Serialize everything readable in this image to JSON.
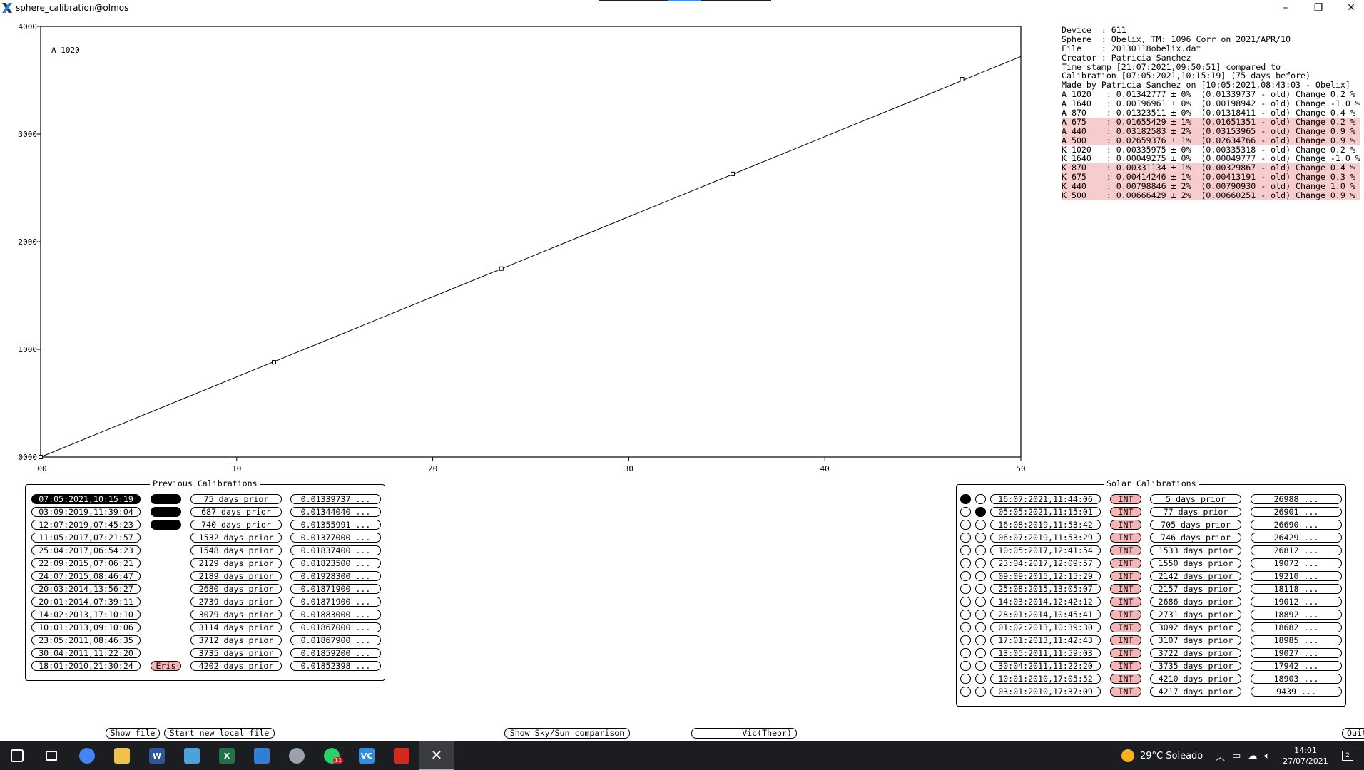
{
  "window": {
    "title": "sphere_calibration@olmos",
    "minimize_glyph": "–",
    "restore_glyph": "❐",
    "close_glyph": "✕"
  },
  "chart_data": {
    "type": "line",
    "annotation": "A 1020",
    "xlim": [
      0,
      50
    ],
    "ylim": [
      0,
      4000
    ],
    "x_ticks": [
      10,
      20,
      30,
      40,
      50
    ],
    "x_tick_labels": [
      "10",
      "20",
      "30",
      "40",
      "50"
    ],
    "x_origin_label": "00",
    "y_ticks": [
      1000,
      2000,
      3000,
      4000
    ],
    "y_tick_labels": [
      "1000",
      "2000",
      "3000",
      "4000"
    ],
    "y_origin_label": "0000",
    "line": {
      "x": [
        0,
        50
      ],
      "y": [
        0,
        3720
      ]
    },
    "points": {
      "x": [
        0,
        11.9,
        23.5,
        35.3,
        47.0
      ],
      "y": [
        0,
        880,
        1750,
        2630,
        3510
      ]
    }
  },
  "info": {
    "rows": [
      {
        "text": "Device  : 611",
        "hl": false
      },
      {
        "text": "Sphere  : Obelix, TM: 1096 Corr on 2021/APR/10",
        "hl": false
      },
      {
        "text": "File    : 20130118obelix.dat",
        "hl": false
      },
      {
        "text": "Creator : Patricia Sanchez",
        "hl": false
      },
      {
        "text": "Time stamp [21:07:2021,09:50:51] compared to",
        "hl": false
      },
      {
        "text": "Calibration [07:05:2021,10:15:19] (75 days before)",
        "hl": false
      },
      {
        "text": "Made by Patricia Sanchez on [10:05:2021,08:43:03 - Obelix]",
        "hl": false
      },
      {
        "text": "A 1020   : 0.01342777 ± 0%  (0.01339737 - old) Change 0.2 %",
        "hl": false
      },
      {
        "text": "A 1640   : 0.00196961 ± 0%  (0.00198942 - old) Change -1.0 %",
        "hl": false
      },
      {
        "text": "A 870    : 0.01323511 ± 0%  (0.01318411 - old) Change 0.4 %",
        "hl": false
      },
      {
        "text": "A 675    : 0.01655429 ± 1%  (0.01651351 - old) Change 0.2 %",
        "hl": true
      },
      {
        "text": "A 440    : 0.03182583 ± 2%  (0.03153965 - old) Change 0.9 %",
        "hl": true
      },
      {
        "text": "A 500    : 0.02659376 ± 1%  (0.02634766 - old) Change 0.9 %",
        "hl": true
      },
      {
        "text": "K 1020   : 0.00335975 ± 0%  (0.00335318 - old) Change 0.2 %",
        "hl": false
      },
      {
        "text": "K 1640   : 0.00049275 ± 0%  (0.00049777 - old) Change -1.0 %",
        "hl": false
      },
      {
        "text": "K 870    : 0.00331134 ± 1%  (0.00329867 - old) Change 0.4 %",
        "hl": true
      },
      {
        "text": "K 675    : 0.00414246 ± 1%  (0.00413191 - old) Change 0.3 %",
        "hl": true
      },
      {
        "text": "K 440    : 0.00798846 ± 2%  (0.00790930 - old) Change 1.0 %",
        "hl": true
      },
      {
        "text": "K 500    : 0.00666429 ± 2%  (0.00660251 - old) Change 0.9 %",
        "hl": true
      }
    ]
  },
  "previous_calibrations": {
    "title": "Previous Calibrations",
    "rows": [
      {
        "date": "07:05:2021,10:15:19",
        "selected": true,
        "tag": "",
        "tag_style": "black",
        "days": "75 days prior",
        "value": "0.01339737 ..."
      },
      {
        "date": "03:09:2019,11:39:04",
        "selected": false,
        "tag": "",
        "tag_style": "black",
        "days": "687 days prior",
        "value": "0.01344040 ..."
      },
      {
        "date": "12:07:2019,07:45:23",
        "selected": false,
        "tag": "",
        "tag_style": "black",
        "days": "740 days prior",
        "value": "0.01355991 ..."
      },
      {
        "date": "11:05:2017,07:21:57",
        "selected": false,
        "tag": "",
        "tag_style": "none",
        "days": "1532 days prior",
        "value": "0.01377000 ..."
      },
      {
        "date": "25:04:2017,06:54:23",
        "selected": false,
        "tag": "",
        "tag_style": "none",
        "days": "1548 days prior",
        "value": "0.01837400 ..."
      },
      {
        "date": "22:09:2015,07:06:21",
        "selected": false,
        "tag": "",
        "tag_style": "none",
        "days": "2129 days prior",
        "value": "0.01823500 ..."
      },
      {
        "date": "24:07:2015,08:46:47",
        "selected": false,
        "tag": "",
        "tag_style": "none",
        "days": "2189 days prior",
        "value": "0.01928300 ..."
      },
      {
        "date": "20:03:2014,13:56:27",
        "selected": false,
        "tag": "",
        "tag_style": "none",
        "days": "2680 days prior",
        "value": "0.01871900 ..."
      },
      {
        "date": "20:01:2014,07:39:11",
        "selected": false,
        "tag": "",
        "tag_style": "none",
        "days": "2739 days prior",
        "value": "0.01871900 ..."
      },
      {
        "date": "14:02:2013,17:10:10",
        "selected": false,
        "tag": "",
        "tag_style": "none",
        "days": "3079 days prior",
        "value": "0.01883000 ..."
      },
      {
        "date": "10:01:2013,09:10:06",
        "selected": false,
        "tag": "",
        "tag_style": "none",
        "days": "3114 days prior",
        "value": "0.01867000 ..."
      },
      {
        "date": "23:05:2011,08:46:35",
        "selected": false,
        "tag": "",
        "tag_style": "none",
        "days": "3712 days prior",
        "value": "0.01867900 ..."
      },
      {
        "date": "30:04:2011,11:22:20",
        "selected": false,
        "tag": "",
        "tag_style": "none",
        "days": "3735 days prior",
        "value": "0.01859200 ..."
      },
      {
        "date": "18:01:2010,21:30:24",
        "selected": false,
        "tag": "Eris",
        "tag_style": "red",
        "days": "4202 days prior",
        "value": "0.01852398 ..."
      }
    ]
  },
  "solar_calibrations": {
    "title": "Solar Calibrations",
    "rows": [
      {
        "r1": true,
        "r2": false,
        "date": "16:07:2021,11:44:06",
        "type": "INT",
        "days": "5 days prior",
        "value": "26988 ..."
      },
      {
        "r1": false,
        "r2": true,
        "date": "05:05:2021,11:15:01",
        "type": "INT",
        "days": "77 days prior",
        "value": "26901 ..."
      },
      {
        "r1": false,
        "r2": false,
        "date": "16:08:2019,11:53:42",
        "type": "INT",
        "days": "705 days prior",
        "value": "26690 ..."
      },
      {
        "r1": false,
        "r2": false,
        "date": "06:07:2019,11:53:29",
        "type": "INT",
        "days": "746 days prior",
        "value": "26429 ..."
      },
      {
        "r1": false,
        "r2": false,
        "date": "10:05:2017,12:41:54",
        "type": "INT",
        "days": "1533 days prior",
        "value": "26812 ..."
      },
      {
        "r1": false,
        "r2": false,
        "date": "23:04:2017,12:09:57",
        "type": "INT",
        "days": "1550 days prior",
        "value": "19072 ..."
      },
      {
        "r1": false,
        "r2": false,
        "date": "09:09:2015,12:15:29",
        "type": "INT",
        "days": "2142 days prior",
        "value": "19210 ..."
      },
      {
        "r1": false,
        "r2": false,
        "date": "25:08:2015,13:05:07",
        "type": "INT",
        "days": "2157 days prior",
        "value": "18118 ..."
      },
      {
        "r1": false,
        "r2": false,
        "date": "14:03:2014,12:42:12",
        "type": "INT",
        "days": "2686 days prior",
        "value": "19012 ..."
      },
      {
        "r1": false,
        "r2": false,
        "date": "28:01:2014,10:45:41",
        "type": "INT",
        "days": "2731 days prior",
        "value": "18892 ..."
      },
      {
        "r1": false,
        "r2": false,
        "date": "01:02:2013,10:39:30",
        "type": "INT",
        "days": "3092 days prior",
        "value": "18682 ..."
      },
      {
        "r1": false,
        "r2": false,
        "date": "17:01:2013,11:42:43",
        "type": "INT",
        "days": "3107 days prior",
        "value": "18985 ..."
      },
      {
        "r1": false,
        "r2": false,
        "date": "13:05:2011,11:59:03",
        "type": "INT",
        "days": "3722 days prior",
        "value": "19027 ..."
      },
      {
        "r1": false,
        "r2": false,
        "date": "30:04:2011,11:22:20",
        "type": "INT",
        "days": "3735 days prior",
        "value": "17942 ..."
      },
      {
        "r1": false,
        "r2": false,
        "date": "10:01:2010,17:05:52",
        "type": "INT",
        "days": "4210 days prior",
        "value": "18903 ..."
      },
      {
        "r1": false,
        "r2": false,
        "date": "03:01:2010,17:37:09",
        "type": "INT",
        "days": "4217 days prior",
        "value": "9439 ..."
      }
    ]
  },
  "buttons": {
    "show_file": "Show file",
    "start_new_local_file": "Start new local file",
    "show_sky_sun": "Show Sky/Sun comparison",
    "vic_theor": "Vic(Theor)",
    "quit": "Quit"
  },
  "taskbar": {
    "apps": [
      {
        "name": "start-icon",
        "label": "",
        "color": "#ffffff"
      },
      {
        "name": "task-view-icon",
        "label": "",
        "color": "#ffffff"
      },
      {
        "name": "chrome-icon",
        "label": "",
        "color": "#4285f4"
      },
      {
        "name": "file-explorer-icon",
        "label": "",
        "color": "#f0c24b"
      },
      {
        "name": "word-icon",
        "label": "W",
        "color": "#2b579a"
      },
      {
        "name": "image-app-icon",
        "label": "",
        "color": "#4aa3df"
      },
      {
        "name": "excel-icon",
        "label": "X",
        "color": "#217346"
      },
      {
        "name": "photos-icon",
        "label": "",
        "color": "#2f7fd8"
      },
      {
        "name": "paint-icon",
        "label": "",
        "color": "#9aa3ad"
      },
      {
        "name": "whatsapp-icon",
        "label": "",
        "color": "#25d366"
      },
      {
        "name": "visual-studio-code-icon",
        "label": "VC",
        "color": "#2f8ee0"
      },
      {
        "name": "acrobat-icon",
        "label": "",
        "color": "#d6281c"
      },
      {
        "name": "x-server-icon",
        "label": "",
        "color": "#333333"
      }
    ],
    "whatsapp_badge": "11",
    "weather": "29°C  Soleado",
    "time": "14:01",
    "date": "27/07/2021",
    "notifications": "2"
  }
}
